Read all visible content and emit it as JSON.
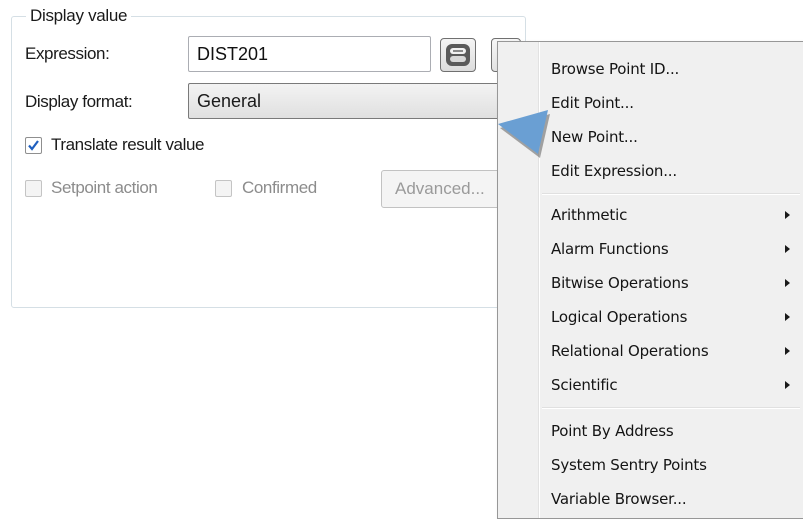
{
  "group": {
    "title": "Display value"
  },
  "expression": {
    "label": "Expression:",
    "value": "DIST201"
  },
  "display_format": {
    "label": "Display format:",
    "value": "General"
  },
  "translate": {
    "label": "Translate result value",
    "checked": true
  },
  "setpoint": {
    "label": "Setpoint action",
    "checked": false,
    "enabled": false
  },
  "confirmed": {
    "label": "Confirmed",
    "checked": false,
    "enabled": false
  },
  "advanced": {
    "label": "Advanced..."
  },
  "colors": {
    "accent_check": "#1f5fbf",
    "cursor": "#6a9fd3"
  },
  "menu": {
    "items": [
      {
        "label": "Browse Point ID...",
        "submenu": false
      },
      {
        "label": "Edit Point...",
        "submenu": false
      },
      {
        "label": "New Point...",
        "submenu": false
      },
      {
        "label": "Edit Expression...",
        "submenu": false
      },
      {
        "label": "Arithmetic",
        "submenu": true
      },
      {
        "label": "Alarm Functions",
        "submenu": true
      },
      {
        "label": "Bitwise Operations",
        "submenu": true
      },
      {
        "label": "Logical Operations",
        "submenu": true
      },
      {
        "label": "Relational Operations",
        "submenu": true
      },
      {
        "label": "Scientific",
        "submenu": true
      },
      {
        "label": "Point By Address",
        "submenu": false
      },
      {
        "label": "System Sentry Points",
        "submenu": false
      },
      {
        "label": "Variable Browser...",
        "submenu": false
      }
    ]
  }
}
